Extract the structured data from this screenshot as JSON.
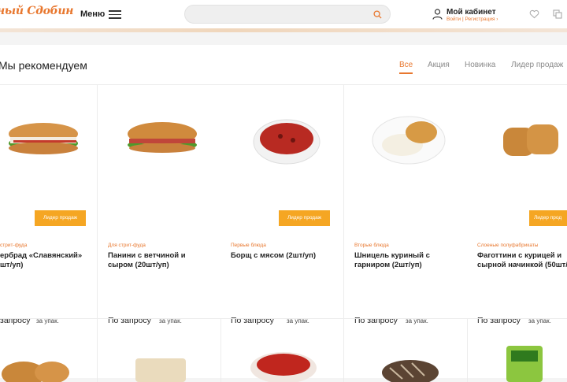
{
  "header": {
    "logo_text": "ный Сдобин",
    "menu_label": "Меню",
    "search_placeholder": "",
    "account_title": "Мой кабинет",
    "account_links": "Войти | Регистрация ›"
  },
  "section": {
    "title": "Мы рекомендуем",
    "tabs": [
      "Все",
      "Акция",
      "Новинка",
      "Лидер продаж"
    ]
  },
  "products": [
    {
      "category": "стрит-фуда",
      "name": "ербрад «Славянский» шт/уп)",
      "badge": "Лидер продаж",
      "price": "запросу",
      "unit": "за упак.",
      "image": "hotdog-sandwich"
    },
    {
      "category": "Для стрит-фуда",
      "name": "Панини с ветчиной и сыром (20шт/уп)",
      "badge": "",
      "price": "По запросу",
      "unit": "за упак.",
      "image": "panini"
    },
    {
      "category": "Первые блюда",
      "name": "Борщ с мясом (2шт/уп)",
      "badge": "Лидер продаж",
      "price": "По запросу",
      "unit": "за упак.",
      "image": "borscht-bowl"
    },
    {
      "category": "Вторые блюда",
      "name": "Шницель куриный с гарниром (2шт/уп)",
      "badge": "",
      "price": "По запросу",
      "unit": "за упак.",
      "image": "schnitzel-plate"
    },
    {
      "category": "Слоеные полуфабрикаты",
      "name": "Фаготтини с курицей и сырной начинкой (50шт/",
      "badge": "Лидер прод",
      "price": "По запросу",
      "unit": "за упак.",
      "image": "fagottini"
    }
  ],
  "colors": {
    "accent": "#e8772e",
    "badge": "#f5a623"
  }
}
